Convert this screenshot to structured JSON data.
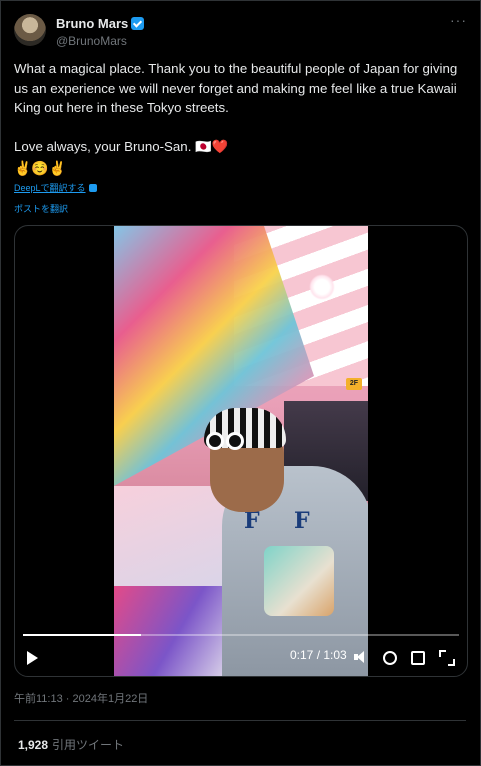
{
  "author": {
    "name": "Bruno Mars",
    "handle": "@BrunoMars",
    "verified_color": "#1d9bf0"
  },
  "more_menu": "···",
  "tweet": {
    "text": "What a magical place. Thank you to the beautiful people of Japan for giving us an experience we will never forget and making me feel like a true Kawaii King out here in these Tokyo streets.\n\nLove always, your Bruno-San. 🇯🇵❤️",
    "emojis": "✌️☺️✌️",
    "deepl_link": "DeepLで翻訳する",
    "translate_link": "ポストを翻訳"
  },
  "video": {
    "progress_fraction": 0.27,
    "time": "0:17 / 1:03",
    "sign_label": "2F",
    "shirt_letters": [
      "F",
      "F"
    ]
  },
  "meta": {
    "timestamp": "午前11:13 · 2024年1月22日"
  },
  "stats": {
    "quote_count": "1,928",
    "quote_label": "引用ツイート"
  }
}
